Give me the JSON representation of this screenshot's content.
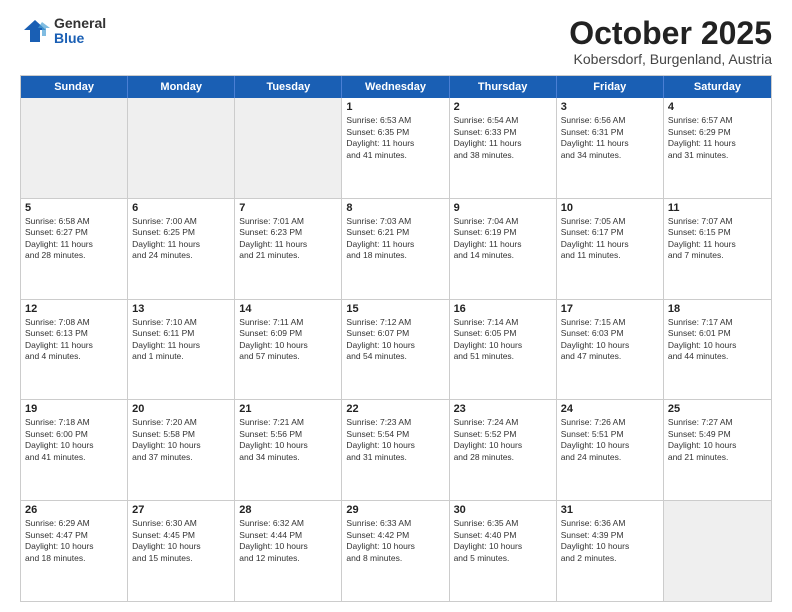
{
  "logo": {
    "general": "General",
    "blue": "Blue"
  },
  "header": {
    "month": "October 2025",
    "location": "Kobersdorf, Burgenland, Austria"
  },
  "days_of_week": [
    "Sunday",
    "Monday",
    "Tuesday",
    "Wednesday",
    "Thursday",
    "Friday",
    "Saturday"
  ],
  "weeks": [
    [
      {
        "day": "",
        "text": "",
        "shaded": true,
        "empty": true
      },
      {
        "day": "",
        "text": "",
        "shaded": true,
        "empty": true
      },
      {
        "day": "",
        "text": "",
        "shaded": true,
        "empty": true
      },
      {
        "day": "1",
        "text": "Sunrise: 6:53 AM\nSunset: 6:35 PM\nDaylight: 11 hours\nand 41 minutes."
      },
      {
        "day": "2",
        "text": "Sunrise: 6:54 AM\nSunset: 6:33 PM\nDaylight: 11 hours\nand 38 minutes."
      },
      {
        "day": "3",
        "text": "Sunrise: 6:56 AM\nSunset: 6:31 PM\nDaylight: 11 hours\nand 34 minutes."
      },
      {
        "day": "4",
        "text": "Sunrise: 6:57 AM\nSunset: 6:29 PM\nDaylight: 11 hours\nand 31 minutes."
      }
    ],
    [
      {
        "day": "5",
        "text": "Sunrise: 6:58 AM\nSunset: 6:27 PM\nDaylight: 11 hours\nand 28 minutes."
      },
      {
        "day": "6",
        "text": "Sunrise: 7:00 AM\nSunset: 6:25 PM\nDaylight: 11 hours\nand 24 minutes."
      },
      {
        "day": "7",
        "text": "Sunrise: 7:01 AM\nSunset: 6:23 PM\nDaylight: 11 hours\nand 21 minutes."
      },
      {
        "day": "8",
        "text": "Sunrise: 7:03 AM\nSunset: 6:21 PM\nDaylight: 11 hours\nand 18 minutes."
      },
      {
        "day": "9",
        "text": "Sunrise: 7:04 AM\nSunset: 6:19 PM\nDaylight: 11 hours\nand 14 minutes."
      },
      {
        "day": "10",
        "text": "Sunrise: 7:05 AM\nSunset: 6:17 PM\nDaylight: 11 hours\nand 11 minutes."
      },
      {
        "day": "11",
        "text": "Sunrise: 7:07 AM\nSunset: 6:15 PM\nDaylight: 11 hours\nand 7 minutes."
      }
    ],
    [
      {
        "day": "12",
        "text": "Sunrise: 7:08 AM\nSunset: 6:13 PM\nDaylight: 11 hours\nand 4 minutes."
      },
      {
        "day": "13",
        "text": "Sunrise: 7:10 AM\nSunset: 6:11 PM\nDaylight: 11 hours\nand 1 minute."
      },
      {
        "day": "14",
        "text": "Sunrise: 7:11 AM\nSunset: 6:09 PM\nDaylight: 10 hours\nand 57 minutes."
      },
      {
        "day": "15",
        "text": "Sunrise: 7:12 AM\nSunset: 6:07 PM\nDaylight: 10 hours\nand 54 minutes."
      },
      {
        "day": "16",
        "text": "Sunrise: 7:14 AM\nSunset: 6:05 PM\nDaylight: 10 hours\nand 51 minutes."
      },
      {
        "day": "17",
        "text": "Sunrise: 7:15 AM\nSunset: 6:03 PM\nDaylight: 10 hours\nand 47 minutes."
      },
      {
        "day": "18",
        "text": "Sunrise: 7:17 AM\nSunset: 6:01 PM\nDaylight: 10 hours\nand 44 minutes."
      }
    ],
    [
      {
        "day": "19",
        "text": "Sunrise: 7:18 AM\nSunset: 6:00 PM\nDaylight: 10 hours\nand 41 minutes."
      },
      {
        "day": "20",
        "text": "Sunrise: 7:20 AM\nSunset: 5:58 PM\nDaylight: 10 hours\nand 37 minutes."
      },
      {
        "day": "21",
        "text": "Sunrise: 7:21 AM\nSunset: 5:56 PM\nDaylight: 10 hours\nand 34 minutes."
      },
      {
        "day": "22",
        "text": "Sunrise: 7:23 AM\nSunset: 5:54 PM\nDaylight: 10 hours\nand 31 minutes."
      },
      {
        "day": "23",
        "text": "Sunrise: 7:24 AM\nSunset: 5:52 PM\nDaylight: 10 hours\nand 28 minutes."
      },
      {
        "day": "24",
        "text": "Sunrise: 7:26 AM\nSunset: 5:51 PM\nDaylight: 10 hours\nand 24 minutes."
      },
      {
        "day": "25",
        "text": "Sunrise: 7:27 AM\nSunset: 5:49 PM\nDaylight: 10 hours\nand 21 minutes."
      }
    ],
    [
      {
        "day": "26",
        "text": "Sunrise: 6:29 AM\nSunset: 4:47 PM\nDaylight: 10 hours\nand 18 minutes."
      },
      {
        "day": "27",
        "text": "Sunrise: 6:30 AM\nSunset: 4:45 PM\nDaylight: 10 hours\nand 15 minutes."
      },
      {
        "day": "28",
        "text": "Sunrise: 6:32 AM\nSunset: 4:44 PM\nDaylight: 10 hours\nand 12 minutes."
      },
      {
        "day": "29",
        "text": "Sunrise: 6:33 AM\nSunset: 4:42 PM\nDaylight: 10 hours\nand 8 minutes."
      },
      {
        "day": "30",
        "text": "Sunrise: 6:35 AM\nSunset: 4:40 PM\nDaylight: 10 hours\nand 5 minutes."
      },
      {
        "day": "31",
        "text": "Sunrise: 6:36 AM\nSunset: 4:39 PM\nDaylight: 10 hours\nand 2 minutes."
      },
      {
        "day": "",
        "text": "",
        "shaded": true,
        "empty": true
      }
    ]
  ]
}
